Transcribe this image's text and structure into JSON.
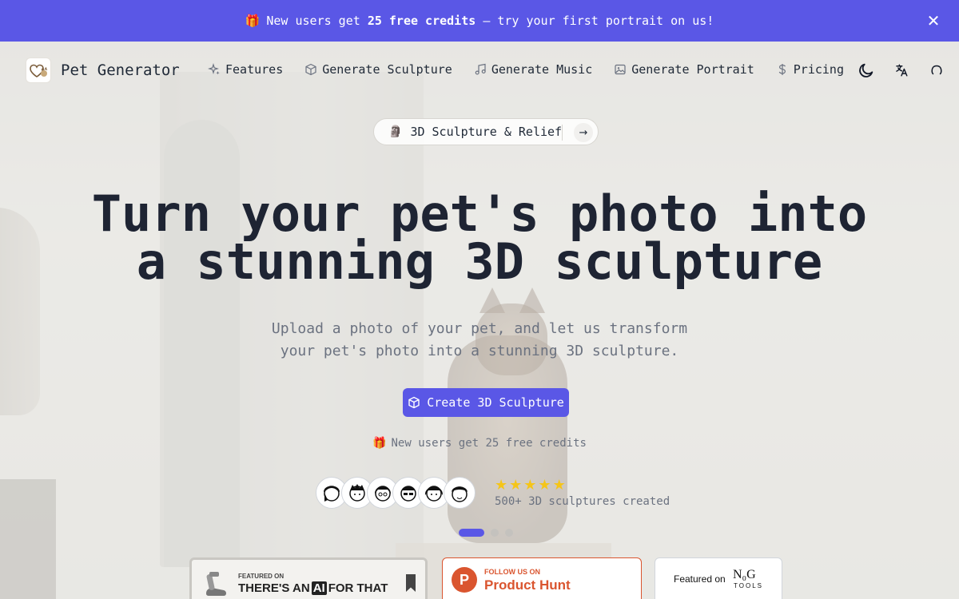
{
  "banner": {
    "emoji": "🎁",
    "text_before": "New users get",
    "highlight": "25 free credits",
    "text_after": "— try your first portrait on us!",
    "close_label": "✕"
  },
  "nav": {
    "brand": "Pet Generator",
    "items": [
      {
        "label": "Features",
        "icon": "sparkles-icon"
      },
      {
        "label": "Generate Sculpture",
        "icon": "cube-icon"
      },
      {
        "label": "Generate Music",
        "icon": "music-note-icon"
      },
      {
        "label": "Generate Portrait",
        "icon": "image-icon"
      },
      {
        "label": "Pricing",
        "icon": "dollar-icon"
      }
    ],
    "right_icons": [
      "moon-icon",
      "translate-icon",
      "github-icon"
    ]
  },
  "hero": {
    "pill_emoji": "🗿",
    "pill_label": "3D Sculpture & Relief",
    "title_line1": "Turn your pet's photo into",
    "title_line2": "a stunning 3D sculpture",
    "subtitle_line1": "Upload a photo of your pet, and let us transform",
    "subtitle_line2": "your pet's photo into a stunning 3D sculpture.",
    "cta_label": "Create 3D Sculpture",
    "credits_emoji": "🎁",
    "credits_text": "New users get 25 free credits",
    "rating_stars": 5,
    "made_text": "500+ 3D sculptures created",
    "avatar_count": 6,
    "carousel": {
      "total": 3,
      "active": 1
    }
  },
  "badges": {
    "aiforthat": {
      "small": "FEATURED ON",
      "big_before": "THERE'S AN",
      "big_ai": "AI",
      "big_after": "FOR THAT"
    },
    "producthunt": {
      "letter": "P",
      "small": "FOLLOW US ON",
      "big": "Product Hunt"
    },
    "nav_tools": {
      "small": "Featured on",
      "logo": "N₀G",
      "tools": "TOOLS"
    }
  },
  "colors": {
    "accent": "#5a57e6",
    "product_hunt": "#da552f",
    "star": "#f5c518"
  }
}
